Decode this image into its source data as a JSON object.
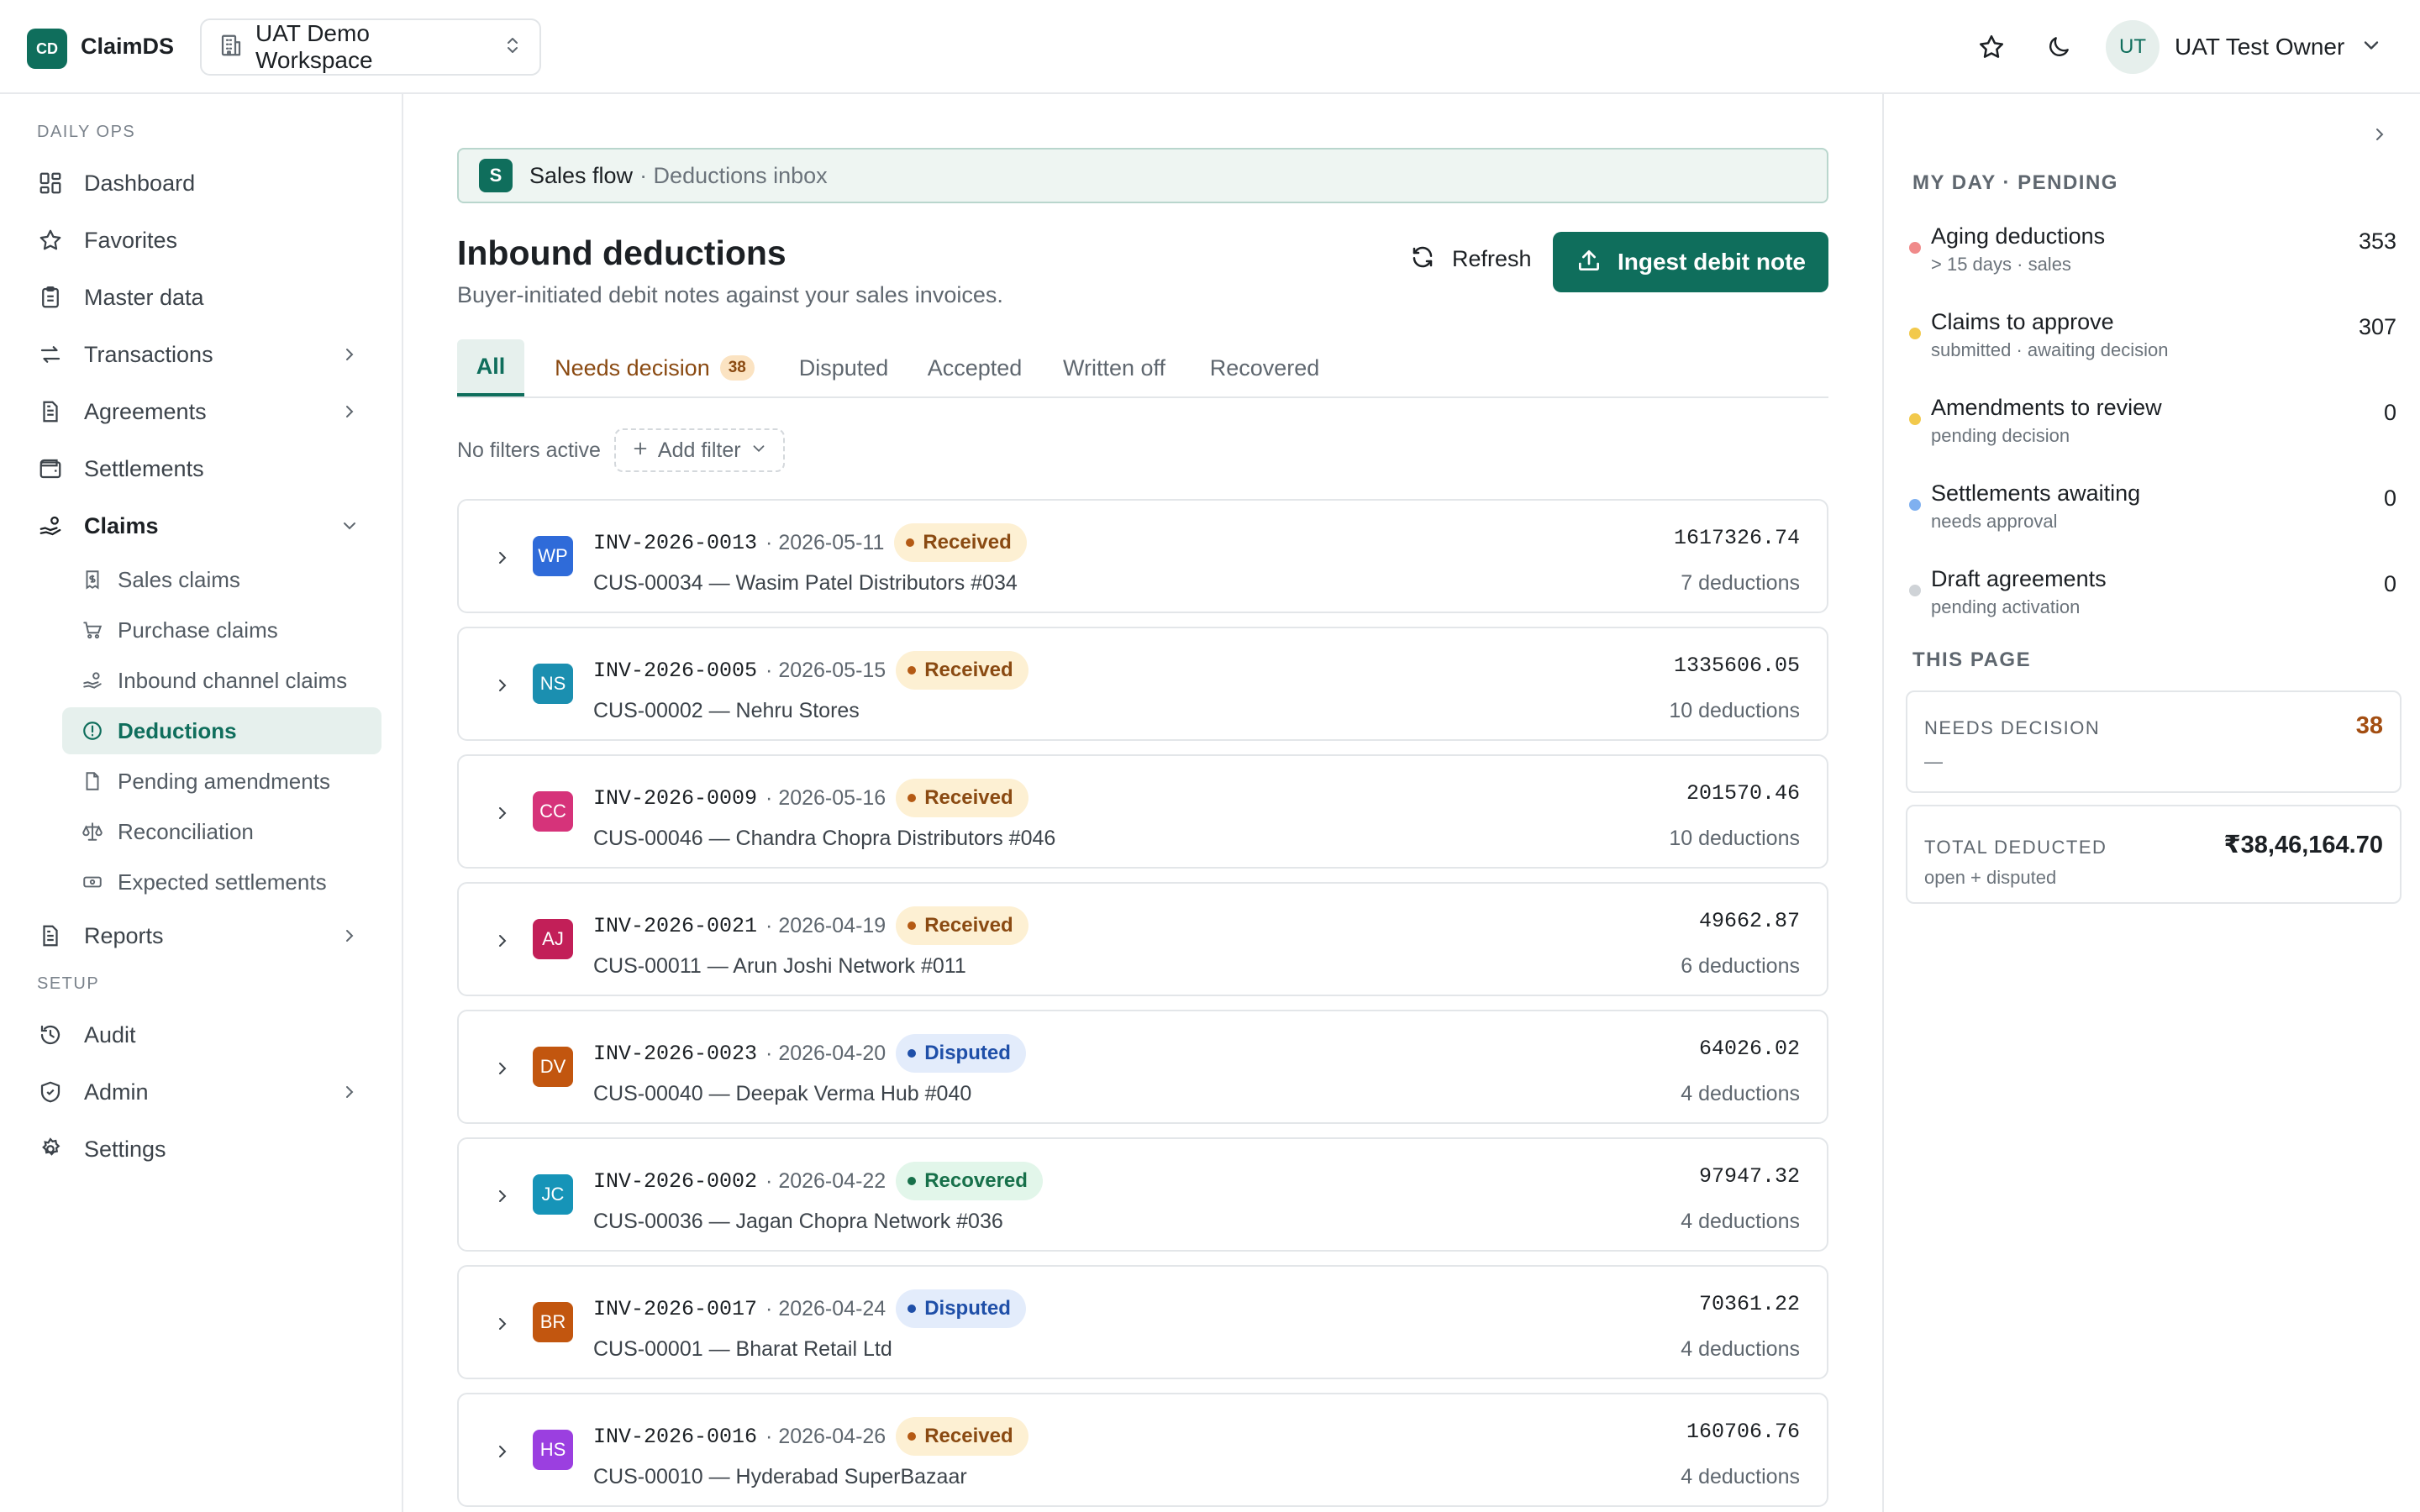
{
  "header": {
    "logo_initials": "CD",
    "app_name": "ClaimDS",
    "workspace": "UAT Demo Workspace",
    "user_initials": "UT",
    "user_name": "UAT Test Owner",
    "icons": [
      "building-icon",
      "sort-arrows-icon",
      "star-icon",
      "moon-icon",
      "chevron-down-icon"
    ]
  },
  "sidebar": {
    "section_daily": "DAILY OPS",
    "section_setup": "SETUP",
    "items": [
      {
        "label": "Dashboard",
        "icon": "dashboard-icon"
      },
      {
        "label": "Favorites",
        "icon": "star-icon"
      },
      {
        "label": "Master data",
        "icon": "clipboard-icon"
      },
      {
        "label": "Transactions",
        "icon": "arrows-icon"
      },
      {
        "label": "Agreements",
        "icon": "document-icon"
      },
      {
        "label": "Settlements",
        "icon": "wallet-icon"
      },
      {
        "label": "Claims",
        "icon": "hand-coins-icon"
      },
      {
        "label": "Reports",
        "icon": "report-icon"
      },
      {
        "label": "Audit",
        "icon": "history-icon"
      },
      {
        "label": "Admin",
        "icon": "shield-icon"
      },
      {
        "label": "Settings",
        "icon": "gear-icon"
      }
    ],
    "claims_sub": [
      {
        "label": "Sales claims",
        "icon": "receipt-icon"
      },
      {
        "label": "Purchase claims",
        "icon": "cart-icon"
      },
      {
        "label": "Inbound channel claims",
        "icon": "hand-coins-icon"
      },
      {
        "label": "Deductions",
        "icon": "alert-circle-icon"
      },
      {
        "label": "Pending amendments",
        "icon": "file-icon"
      },
      {
        "label": "Reconciliation",
        "icon": "scale-icon"
      },
      {
        "label": "Expected settlements",
        "icon": "banknote-icon"
      }
    ]
  },
  "main": {
    "flow_badge": "S",
    "flow_title": "Sales flow",
    "flow_sub": "· Deductions inbox",
    "title": "Inbound deductions",
    "subtitle": "Buyer-initiated debit notes against your sales invoices.",
    "refresh_label": "Refresh",
    "ingest_label": "Ingest debit note",
    "tabs": [
      {
        "label": "All"
      },
      {
        "label": "Needs decision",
        "count": "38"
      },
      {
        "label": "Disputed"
      },
      {
        "label": "Accepted"
      },
      {
        "label": "Written off"
      },
      {
        "label": "Recovered"
      }
    ],
    "filters_none": "No filters active",
    "add_filter": "Add filter",
    "rows": [
      {
        "initials": "WP",
        "color": "#2f6bd9",
        "invoice": "INV-2026-0013",
        "date": "· 2026-05-11",
        "status": "Received",
        "customer": "CUS-00034 — Wasim Patel Distributors #034",
        "amount": "1617326.74",
        "deductions": "7 deductions"
      },
      {
        "initials": "NS",
        "color": "#1b8fb0",
        "invoice": "INV-2026-0005",
        "date": "· 2026-05-15",
        "status": "Received",
        "customer": "CUS-00002 — Nehru Stores",
        "amount": "1335606.05",
        "deductions": "10 deductions"
      },
      {
        "initials": "CC",
        "color": "#d6337a",
        "invoice": "INV-2026-0009",
        "date": "· 2026-05-16",
        "status": "Received",
        "customer": "CUS-00046 — Chandra Chopra Distributors #046",
        "amount": "201570.46",
        "deductions": "10 deductions"
      },
      {
        "initials": "AJ",
        "color": "#c21f58",
        "invoice": "INV-2026-0021",
        "date": "· 2026-04-19",
        "status": "Received",
        "customer": "CUS-00011 — Arun Joshi Network #011",
        "amount": "49662.87",
        "deductions": "6 deductions"
      },
      {
        "initials": "DV",
        "color": "#c2560f",
        "invoice": "INV-2026-0023",
        "date": "· 2026-04-20",
        "status": "Disputed",
        "customer": "CUS-00040 — Deepak Verma Hub #040",
        "amount": "64026.02",
        "deductions": "4 deductions"
      },
      {
        "initials": "JC",
        "color": "#1694b8",
        "invoice": "INV-2026-0002",
        "date": "· 2026-04-22",
        "status": "Recovered",
        "customer": "CUS-00036 — Jagan Chopra Network #036",
        "amount": "97947.32",
        "deductions": "4 deductions"
      },
      {
        "initials": "BR",
        "color": "#c2560f",
        "invoice": "INV-2026-0017",
        "date": "· 2026-04-24",
        "status": "Disputed",
        "customer": "CUS-00001 — Bharat Retail Ltd",
        "amount": "70361.22",
        "deductions": "4 deductions"
      },
      {
        "initials": "HS",
        "color": "#9b3fe0",
        "invoice": "INV-2026-0016",
        "date": "· 2026-04-26",
        "status": "Received",
        "customer": "CUS-00010 — Hyderabad SuperBazaar",
        "amount": "160706.76",
        "deductions": "4 deductions"
      }
    ]
  },
  "status_styles": {
    "Received": {
      "bg": "#fdf0d3",
      "fg": "#8a4a12",
      "dot": "#b45a14"
    },
    "Disputed": {
      "bg": "#e3ecfb",
      "fg": "#1f4fa8",
      "dot": "#1f4fa8"
    },
    "Recovered": {
      "bg": "#e2f6ea",
      "fg": "#17704a",
      "dot": "#17704a"
    }
  },
  "right_panel": {
    "my_day_heading": "MY DAY · PENDING",
    "pending": [
      {
        "title": "Aging deductions",
        "sub": "> 15 days · sales",
        "count": "353",
        "dot": "#f08a8a"
      },
      {
        "title": "Claims to approve",
        "sub": "submitted · awaiting decision",
        "count": "307",
        "dot": "#f2c94c"
      },
      {
        "title": "Amendments to review",
        "sub": "pending decision",
        "count": "0",
        "dot": "#f2c94c"
      },
      {
        "title": "Settlements awaiting",
        "sub": "needs approval",
        "count": "0",
        "dot": "#7fb0f0"
      },
      {
        "title": "Draft agreements",
        "sub": "pending activation",
        "count": "0",
        "dot": "#cfd3d7"
      }
    ],
    "this_page_heading": "THIS PAGE",
    "needs_decision_label": "NEEDS DECISION",
    "needs_decision_value": "38",
    "needs_decision_sub": "—",
    "total_label": "TOTAL DEDUCTED",
    "total_value": "₹38,46,164.70",
    "total_sub": "open + disputed"
  }
}
